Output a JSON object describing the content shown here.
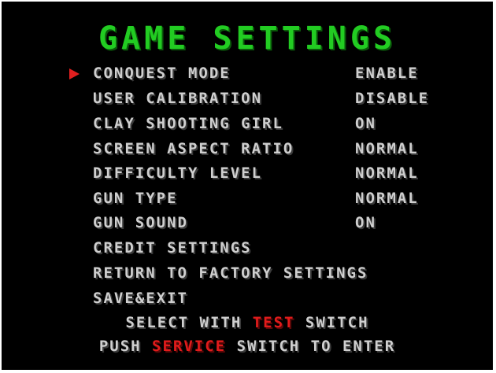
{
  "title": "GAME SETTINGS",
  "menu": [
    {
      "label": "CONQUEST MODE",
      "value": "ENABLE",
      "selected": true
    },
    {
      "label": "USER CALIBRATION",
      "value": "DISABLE"
    },
    {
      "label": "CLAY SHOOTING GIRL",
      "value": "ON"
    },
    {
      "label": "SCREEN ASPECT RATIO",
      "value": "NORMAL"
    },
    {
      "label": "DIFFICULTY LEVEL",
      "value": "NORMAL"
    },
    {
      "label": "GUN TYPE",
      "value": "NORMAL"
    },
    {
      "label": "GUN SOUND",
      "value": "ON"
    },
    {
      "label": "CREDIT SETTINGS",
      "value": ""
    },
    {
      "label": "RETURN TO FACTORY SETTINGS",
      "value": ""
    },
    {
      "label": "SAVE&EXIT",
      "value": ""
    }
  ],
  "footer": {
    "line1_prefix": "SELECT WITH ",
    "line1_key": "TEST",
    "line1_suffix": " SWITCH",
    "line2_prefix": "PUSH ",
    "line2_key": "SERVICE",
    "line2_suffix": " SWITCH TO ENTER"
  },
  "colors": {
    "title": "#22cc22",
    "text": "#cfcfcf",
    "highlight": "#e01b1b",
    "cursor": "#e11f1f",
    "background": "#000000"
  },
  "icons": {
    "cursor": "red-triangle-pointer-icon"
  }
}
